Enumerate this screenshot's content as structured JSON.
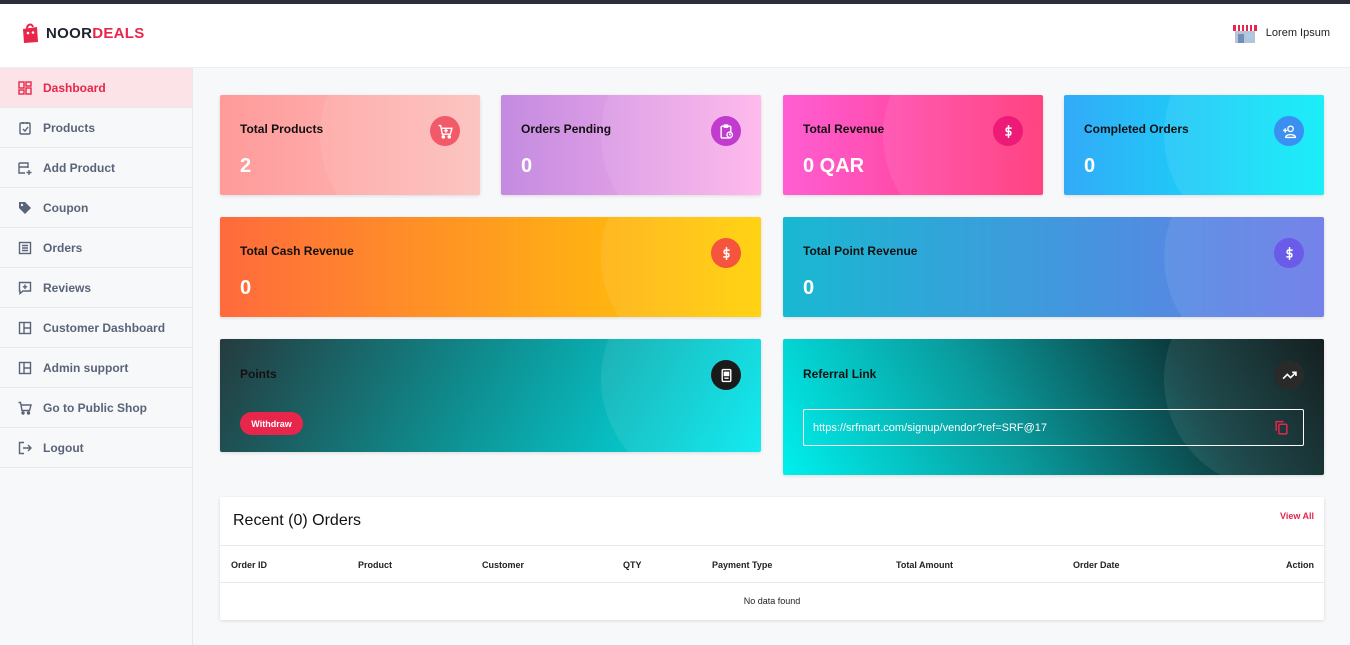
{
  "brand": {
    "part1": "NOOR",
    "part2": "DEALS"
  },
  "user": {
    "name": "Lorem Ipsum"
  },
  "sidebar": {
    "items": [
      {
        "label": "Dashboard",
        "icon": "dashboard-icon"
      },
      {
        "label": "Products",
        "icon": "products-icon"
      },
      {
        "label": "Add Product",
        "icon": "add-product-icon"
      },
      {
        "label": "Coupon",
        "icon": "tag-icon"
      },
      {
        "label": "Orders",
        "icon": "orders-list-icon"
      },
      {
        "label": "Reviews",
        "icon": "review-icon"
      },
      {
        "label": "Customer Dashboard",
        "icon": "layout-icon"
      },
      {
        "label": "Admin support",
        "icon": "layout-icon"
      },
      {
        "label": "Go to Public Shop",
        "icon": "cart-icon"
      },
      {
        "label": "Logout",
        "icon": "logout-icon"
      }
    ]
  },
  "stats": {
    "total_products": {
      "title": "Total Products",
      "value": "2",
      "icon": "cart-icon"
    },
    "orders_pending": {
      "title": "Orders Pending",
      "value": "0",
      "icon": "clipboard-clock-icon"
    },
    "total_revenue": {
      "title": "Total Revenue",
      "value": "0 QAR",
      "icon": "dollar-icon"
    },
    "completed_orders": {
      "title": "Completed Orders",
      "value": "0",
      "icon": "user-add-icon"
    },
    "total_cash_revenue": {
      "title": "Total Cash Revenue",
      "value": "0",
      "icon": "dollar-icon"
    },
    "total_point_revenue": {
      "title": "Total Point Revenue",
      "value": "0",
      "icon": "dollar-icon"
    }
  },
  "points": {
    "title": "Points",
    "withdraw_label": "Withdraw",
    "icon": "wallet-icon"
  },
  "referral": {
    "title": "Referral Link",
    "url": "https://srfmart.com/signup/vendor?ref=SRF@17",
    "icon": "trending-up-icon"
  },
  "recent_orders": {
    "title": "Recent (0) Orders",
    "view_all": "View All",
    "columns": [
      "Order ID",
      "Product",
      "Customer",
      "QTY",
      "Payment Type",
      "Total Amount",
      "Order Date",
      "Action"
    ],
    "empty_text": "No data found"
  },
  "colors": {
    "accent": "#e8254a",
    "sidebar_active_bg": "#fbe3e8"
  }
}
